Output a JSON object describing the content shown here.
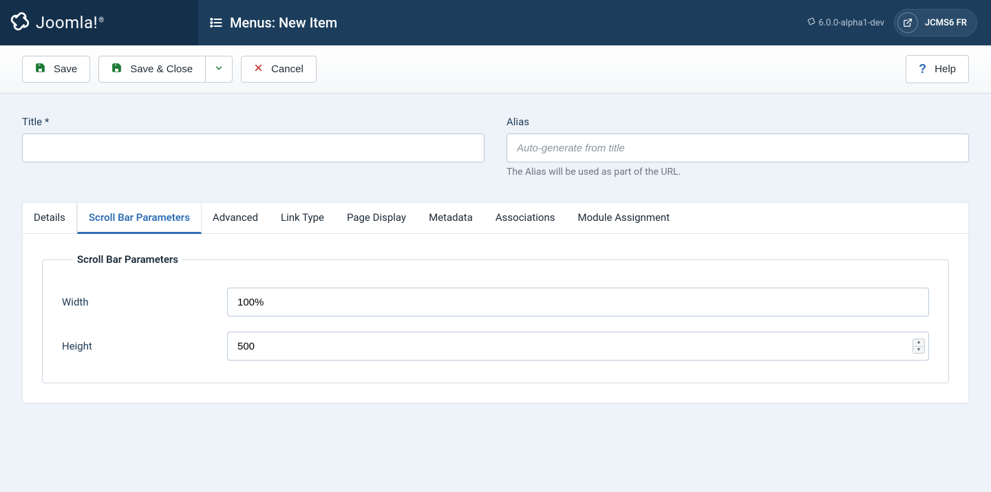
{
  "brand": "Joomla!",
  "page_title": "Menus: New Item",
  "version": "6.0.0-alpha1-dev",
  "site_btn": "JCMS6 FR",
  "toolbar": {
    "save": "Save",
    "save_close": "Save & Close",
    "cancel": "Cancel",
    "help": "Help"
  },
  "fields": {
    "title_label": "Title *",
    "title_value": "",
    "alias_label": "Alias",
    "alias_placeholder": "Auto-generate from title",
    "alias_value": "",
    "alias_hint": "The Alias will be used as part of the URL."
  },
  "tabs": [
    "Details",
    "Scroll Bar Parameters",
    "Advanced",
    "Link Type",
    "Page Display",
    "Metadata",
    "Associations",
    "Module Assignment"
  ],
  "active_tab": 1,
  "fieldset_legend": "Scroll Bar Parameters",
  "params": {
    "width_label": "Width",
    "width_value": "100%",
    "height_label": "Height",
    "height_value": "500"
  }
}
